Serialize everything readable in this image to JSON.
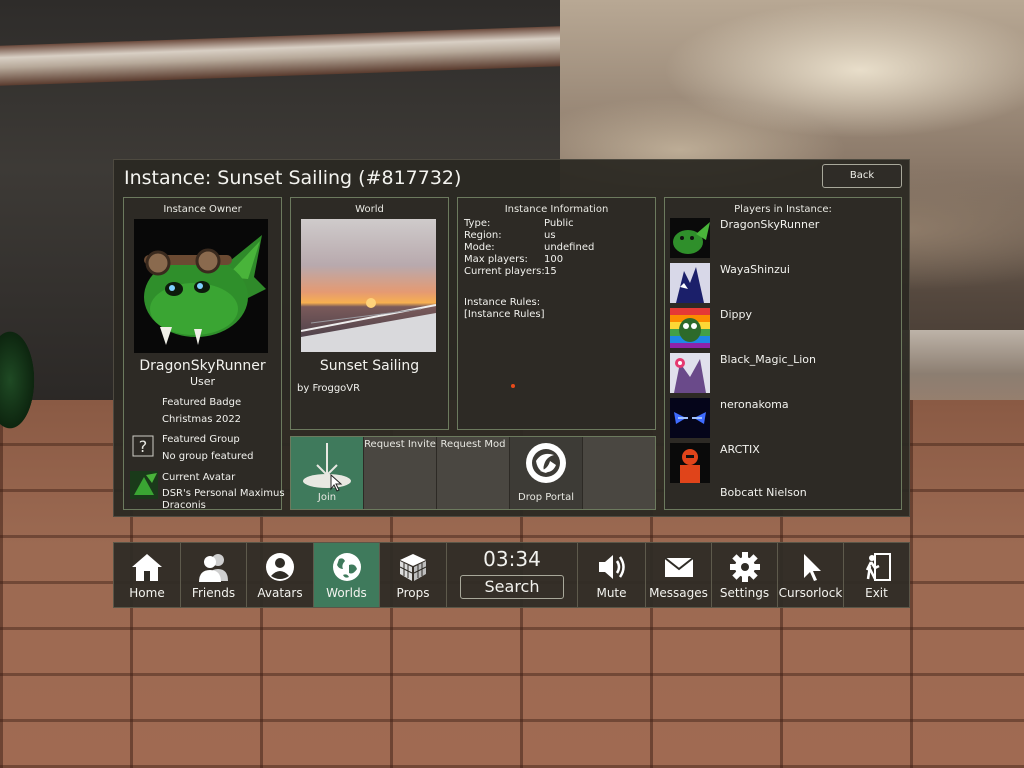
{
  "panel": {
    "title": "Instance: Sunset Sailing (#817732)",
    "back_label": "Back"
  },
  "owner": {
    "header": "Instance Owner",
    "name": "DragonSkyRunner",
    "rank": "User",
    "badge_label": "Featured Badge",
    "badge_value": "Christmas 2022",
    "group_label": "Featured Group",
    "group_value": "No group featured",
    "avatar_label": "Current Avatar",
    "avatar_value_1": "DSR's Personal Maximus",
    "avatar_value_2": "Draconis"
  },
  "world": {
    "header": "World",
    "name": "Sunset Sailing",
    "author": "by FroggoVR"
  },
  "info": {
    "header": "Instance Information",
    "rows": [
      {
        "key": "Type:",
        "value": "Public"
      },
      {
        "key": "Region:",
        "value": "us"
      },
      {
        "key": "Mode:",
        "value": "undefined"
      },
      {
        "key": "Max players:",
        "value": "100"
      },
      {
        "key": "Current players:",
        "value": "15"
      }
    ],
    "rules_label": "Instance Rules:",
    "rules_value": "[Instance Rules]"
  },
  "actions": {
    "join": "Join",
    "request_invite": "Request Invite",
    "request_mod": "Request Mod",
    "drop_portal": "Drop Portal"
  },
  "players": {
    "header": "Players in Instance:",
    "list": [
      {
        "name": "DragonSkyRunner",
        "color": "#2f7a2a"
      },
      {
        "name": "WayaShinzui",
        "color": "#1b1f6a"
      },
      {
        "name": "Dippy",
        "color": "#cc3344"
      },
      {
        "name": "Black_Magic_Lion",
        "color": "#6a4a8a"
      },
      {
        "name": "neronakoma",
        "color": "#1a22aa"
      },
      {
        "name": "ARCTIX",
        "color": "#e0441a"
      },
      {
        "name": "Bobcatt Nielson",
        "color": "#2d2a25"
      }
    ]
  },
  "menu": {
    "home": "Home",
    "friends": "Friends",
    "avatars": "Avatars",
    "worlds": "Worlds",
    "props": "Props",
    "time": "03:34",
    "search": "Search",
    "mute": "Mute",
    "messages": "Messages",
    "settings": "Settings",
    "cursorlock": "Cursorlock",
    "exit": "Exit"
  },
  "colors": {
    "accent_green": "#3f7a5c",
    "panel_bg": "#2b2822",
    "card_border": "#6c7a5e"
  }
}
